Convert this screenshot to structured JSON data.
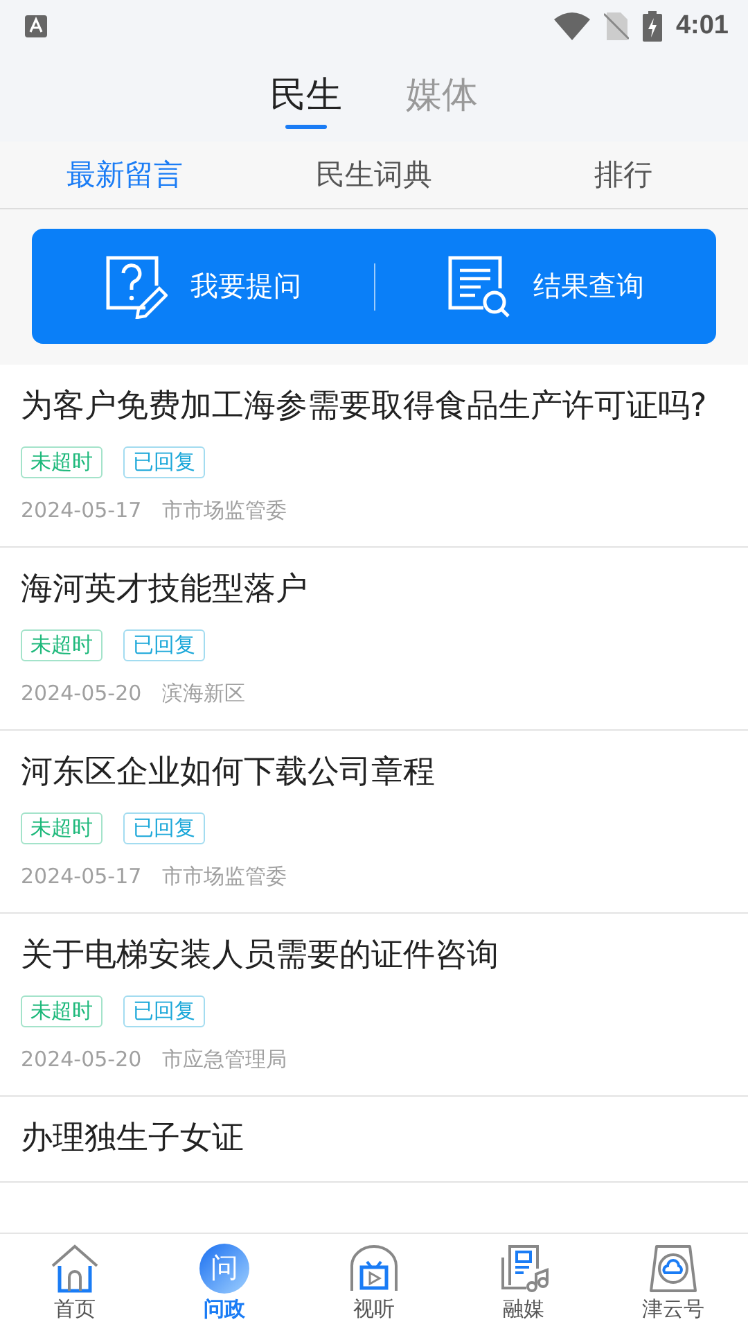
{
  "status_bar": {
    "time": "4:01"
  },
  "top_tabs": [
    {
      "label": "民生",
      "selected": true
    },
    {
      "label": "媒体",
      "selected": false
    }
  ],
  "sub_tabs": [
    {
      "label": "最新留言",
      "selected": true
    },
    {
      "label": "民生词典",
      "selected": false
    },
    {
      "label": "排行",
      "selected": false
    }
  ],
  "banner": {
    "ask": "我要提问",
    "query": "结果查询"
  },
  "messages": [
    {
      "title": "为客户免费加工海参需要取得食品生产许可证吗?",
      "tags": [
        {
          "label": "未超时",
          "color": "#1cb87a"
        },
        {
          "label": "已回复",
          "color": "#1aa7d9"
        }
      ],
      "date": "2024-05-17",
      "department": "市市场监管委"
    },
    {
      "title": "海河英才技能型落户",
      "tags": [
        {
          "label": "未超时",
          "color": "#1cb87a"
        },
        {
          "label": "已回复",
          "color": "#1aa7d9"
        }
      ],
      "date": "2024-05-20",
      "department": "滨海新区"
    },
    {
      "title": "河东区企业如何下载公司章程",
      "tags": [
        {
          "label": "未超时",
          "color": "#1cb87a"
        },
        {
          "label": "已回复",
          "color": "#1aa7d9"
        }
      ],
      "date": "2024-05-17",
      "department": "市市场监管委"
    },
    {
      "title": "关于电梯安装人员需要的证件咨询",
      "tags": [
        {
          "label": "未超时",
          "color": "#1cb87a"
        },
        {
          "label": "已回复",
          "color": "#1aa7d9"
        }
      ],
      "date": "2024-05-20",
      "department": "市应急管理局"
    },
    {
      "title": "办理独生子女证"
    }
  ],
  "bottom_nav": [
    {
      "label": "首页",
      "kind": "home",
      "selected": false
    },
    {
      "label": "问政",
      "kind": "ask",
      "icon_text": "问",
      "selected": true
    },
    {
      "label": "视听",
      "kind": "tv",
      "selected": false
    },
    {
      "label": "融媒",
      "kind": "media",
      "selected": false
    },
    {
      "label": "津云号",
      "kind": "cloud",
      "selected": false
    }
  ]
}
